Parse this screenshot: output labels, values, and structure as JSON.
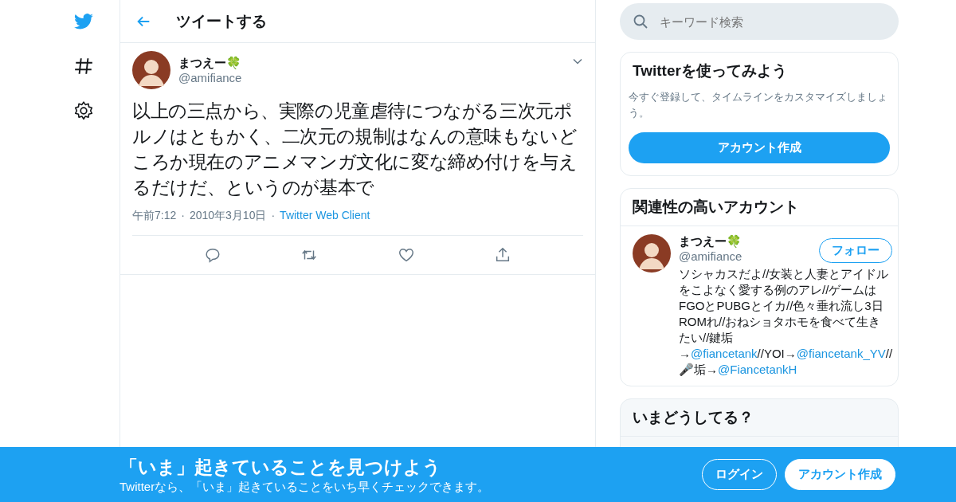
{
  "header": {
    "title": "ツイートする"
  },
  "tweet": {
    "name": "まつえー🍀",
    "handle": "@amifiance",
    "text": "以上の三点から、実際の児童虐待につながる三次元ポルノはともかく、二次元の規制はなんの意味もないどころか現在のアニメマンガ文化に変な締め付けを与えるだけだ、というのが基本で",
    "time": "午前7:12",
    "separator": "·",
    "date": "2010年3月10日",
    "source": "Twitter Web Client"
  },
  "search": {
    "placeholder": "キーワード検索"
  },
  "signup_card": {
    "title": "Twitterを使ってみよう",
    "text": "今すぐ登録して、タイムラインをカスタマイズしましょう。",
    "button": "アカウント作成"
  },
  "related": {
    "title": "関連性の高いアカウント",
    "accounts": [
      {
        "name": "まつえー🍀",
        "handle": "@amifiance",
        "button": "フォロー",
        "bio": [
          {
            "kind": "text",
            "text": "ソシャカスだよ//女装と人妻とアイドルをこよなく愛する例のアレ//ゲームはFGOとPUBGとイカ//色々垂れ流し3日ROMれ//おねショタホモを食べて生きたい//鍵垢→"
          },
          {
            "kind": "link",
            "text": "@fiancetank"
          },
          {
            "kind": "text",
            "text": "//YOI→"
          },
          {
            "kind": "link",
            "text": "@fiancetank_YV"
          },
          {
            "kind": "text",
            "text": "//🎤垢→"
          },
          {
            "kind": "link",
            "text": "@FiancetankH"
          }
        ]
      }
    ]
  },
  "trends": {
    "title": "いまどうしてる？"
  },
  "banner": {
    "title": "「いま」起きていることを見つけよう",
    "subtitle": "Twitterなら、「いま」起きていることをいち早くチェックできます。",
    "buttons": [
      {
        "label": "ログイン",
        "kind": "outline"
      },
      {
        "label": "アカウント作成",
        "kind": "solid"
      }
    ]
  }
}
